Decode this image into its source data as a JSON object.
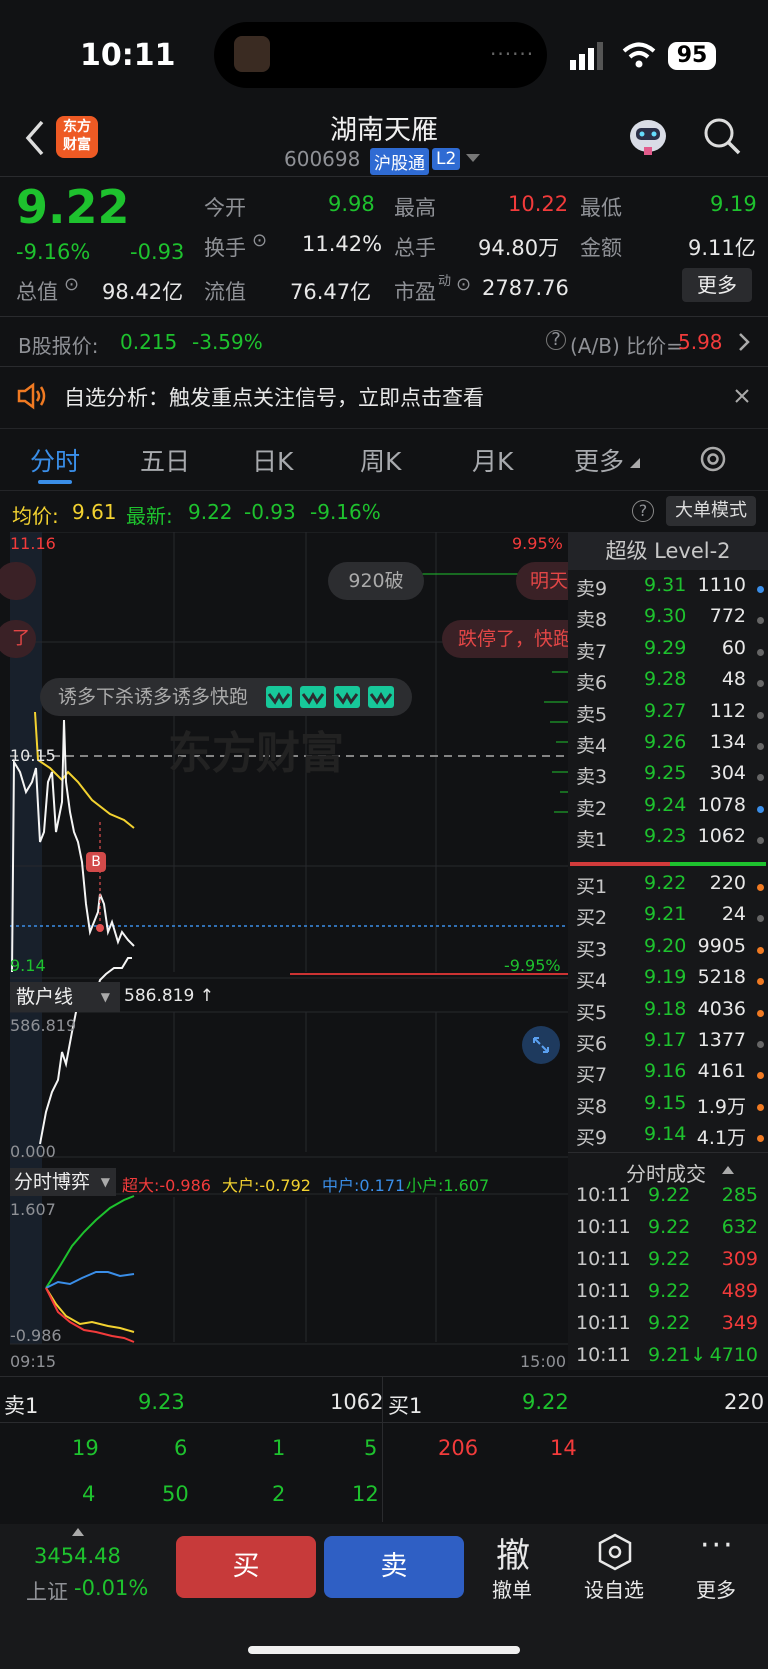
{
  "status": {
    "time": "10:11",
    "battery": "95",
    "dots": "······"
  },
  "header": {
    "title": "湖南天雁",
    "code": "600698",
    "tag1": "沪股通",
    "tag2": "L2",
    "logo_line1": "东方",
    "logo_line2": "财富"
  },
  "quote": {
    "price": "9.22",
    "change_pct": "-9.16%",
    "change": "-0.93",
    "open_label": "今开",
    "open": "9.98",
    "high_label": "最高",
    "high": "10.22",
    "low_label": "最低",
    "low": "9.19",
    "turnover_label": "换手",
    "turnover": "11.42%",
    "volume_label": "总手",
    "volume": "94.80万",
    "amount_label": "金额",
    "amount": "9.11亿",
    "mktcap_label": "总值",
    "mktcap": "98.42亿",
    "float_label": "流值",
    "float": "76.47亿",
    "pe_label": "市盈",
    "pe_sup": "动",
    "pe": "2787.76",
    "more": "更多"
  },
  "bshare": {
    "label": "B股报价:",
    "price": "0.215",
    "pct": "-3.59%",
    "ratio_label": "(A/B) 比价=",
    "ratio": "5.98"
  },
  "notice": {
    "text": "自选分析：触发重点关注信号，立即点击查看"
  },
  "tabs": [
    "分时",
    "五日",
    "日K",
    "周K",
    "月K",
    "更多"
  ],
  "avg_bar": {
    "avg_label": "均价:",
    "avg": "9.61",
    "latest_label": "最新:",
    "latest": "9.22",
    "chg": "-0.93",
    "pct": "-9.16%",
    "mode": "大单模式"
  },
  "chart": {
    "y_top": "11.16",
    "y_top_pct": "9.95%",
    "y_ref": "10.15",
    "y_bottom": "9.14",
    "y_bottom_pct": "-9.95%",
    "bubble1": "920破",
    "bubble2": "明天",
    "bubble3": "跌停了，快跑",
    "bubble4": "诱多下杀诱多诱多快跑",
    "bubble_left1": "",
    "bubble_left2": "了",
    "b_marker": "B",
    "watermark": "东方财富"
  },
  "retail": {
    "label": "散户线",
    "value": "586.819 ↑",
    "top": "586.819",
    "bottom": "0.000"
  },
  "game": {
    "label": "分时博弈",
    "s1": "超大:-0.986",
    "s2": "大户:-0.792",
    "s3": "中户:0.171",
    "s4": "小户:1.607",
    "top": "1.607",
    "bottom": "-0.986",
    "t_start": "09:15",
    "t_end": "15:00"
  },
  "orderbook": {
    "title": "超级 Level-2",
    "asks": [
      {
        "label": "卖9",
        "price": "9.31",
        "vol": "1110",
        "dot": "#3a8ee8"
      },
      {
        "label": "卖8",
        "price": "9.30",
        "vol": "772",
        "dot": "#666"
      },
      {
        "label": "卖7",
        "price": "9.29",
        "vol": "60",
        "dot": "#666"
      },
      {
        "label": "卖6",
        "price": "9.28",
        "vol": "48",
        "dot": "#666"
      },
      {
        "label": "卖5",
        "price": "9.27",
        "vol": "112",
        "dot": "#666"
      },
      {
        "label": "卖4",
        "price": "9.26",
        "vol": "134",
        "dot": "#666"
      },
      {
        "label": "卖3",
        "price": "9.25",
        "vol": "304",
        "dot": "#666"
      },
      {
        "label": "卖2",
        "price": "9.24",
        "vol": "1078",
        "dot": "#3a8ee8"
      },
      {
        "label": "卖1",
        "price": "9.23",
        "vol": "1062",
        "dot": "#666"
      }
    ],
    "bids": [
      {
        "label": "买1",
        "price": "9.22",
        "vol": "220",
        "dot": "#f07a22"
      },
      {
        "label": "买2",
        "price": "9.21",
        "vol": "24",
        "dot": "#666"
      },
      {
        "label": "买3",
        "price": "9.20",
        "vol": "9905",
        "dot": "#f07a22"
      },
      {
        "label": "买4",
        "price": "9.19",
        "vol": "5218",
        "dot": "#f07a22"
      },
      {
        "label": "买5",
        "price": "9.18",
        "vol": "4036",
        "dot": "#f07a22"
      },
      {
        "label": "买6",
        "price": "9.17",
        "vol": "1377",
        "dot": "#666"
      },
      {
        "label": "买7",
        "price": "9.16",
        "vol": "4161",
        "dot": "#f07a22"
      },
      {
        "label": "买8",
        "price": "9.15",
        "vol": "1.9万",
        "dot": "#f07a22"
      },
      {
        "label": "买9",
        "price": "9.14",
        "vol": "4.1万",
        "dot": "#f07a22"
      }
    ],
    "trades_title": "分时成交",
    "trades": [
      {
        "time": "10:11",
        "price": "9.22",
        "vol": "285",
        "color": "#1ec22e"
      },
      {
        "time": "10:11",
        "price": "9.22",
        "vol": "632",
        "color": "#1ec22e"
      },
      {
        "time": "10:11",
        "price": "9.22",
        "vol": "309",
        "color": "#f23b3b"
      },
      {
        "time": "10:11",
        "price": "9.22",
        "vol": "489",
        "color": "#f23b3b"
      },
      {
        "time": "10:11",
        "price": "9.22",
        "vol": "349",
        "color": "#f23b3b"
      },
      {
        "time": "10:11",
        "price": "9.21↓",
        "vol": "4710",
        "color": "#1ec22e"
      }
    ]
  },
  "queue": {
    "ask_label": "卖1",
    "ask_price": "9.23",
    "ask_vol": "1062",
    "bid_label": "买1",
    "bid_price": "9.22",
    "bid_vol": "220",
    "ask_row1": [
      "19",
      "6",
      "1",
      "5"
    ],
    "ask_row2": [
      "4",
      "50",
      "2",
      "12"
    ],
    "bid_row1": [
      "206",
      "14"
    ]
  },
  "bottom": {
    "index_value": "3454.48",
    "index_name": "上证",
    "index_pct": "-0.01%",
    "buy": "买",
    "sell": "卖",
    "cancel_icon": "撤",
    "cancel": "撤单",
    "fav": "设自选",
    "more": "更多"
  }
}
